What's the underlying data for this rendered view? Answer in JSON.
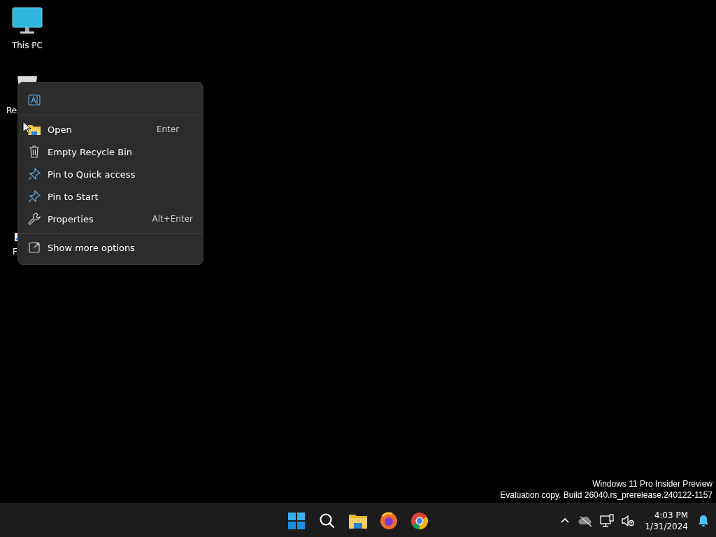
{
  "desktop_icons": [
    {
      "label": "This PC"
    },
    {
      "label": "Re"
    },
    {
      "label": "F"
    }
  ],
  "context_menu": {
    "items": [
      {
        "label": "Open",
        "shortcut": "Enter"
      },
      {
        "label": "Empty Recycle Bin"
      },
      {
        "label": "Pin to Quick access"
      },
      {
        "label": "Pin to Start"
      },
      {
        "label": "Properties",
        "shortcut": "Alt+Enter"
      }
    ],
    "footer": {
      "label": "Show more options"
    }
  },
  "watermark": [
    "Windows 11 Pro Insider Preview",
    "Evaluation copy. Build 26040.rs_prerelease.240122-1157"
  ],
  "taskbar": {
    "time": "4:03 PM",
    "date": "1/31/2024"
  }
}
